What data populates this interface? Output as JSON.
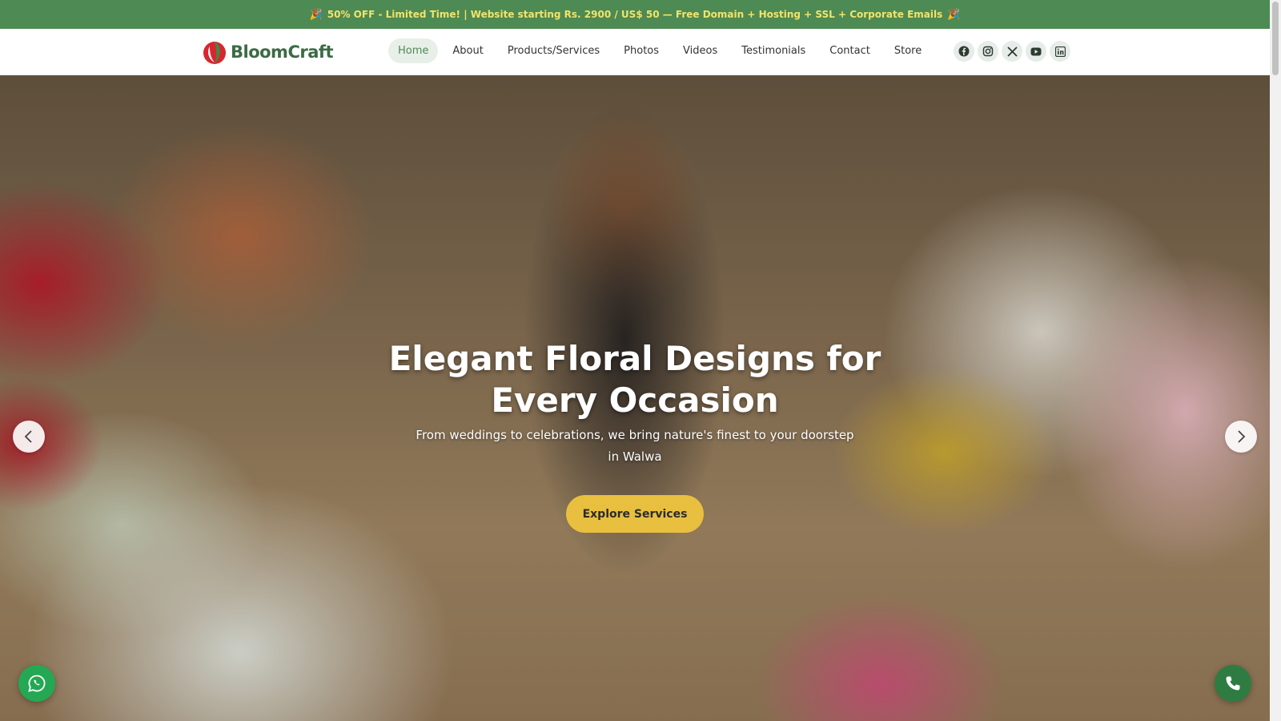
{
  "promo": {
    "emoji_left": "🎉",
    "text": "50% OFF - Limited Time! | Website starting Rs. 2900 / US$ 50 — Free Domain + Hosting + SSL + Corporate Emails",
    "emoji_right": "🎉"
  },
  "brand": {
    "name": "BloomCraft",
    "color": "#3c6b46"
  },
  "nav": {
    "items": [
      {
        "label": "Home"
      },
      {
        "label": "About"
      },
      {
        "label": "Products/Services"
      },
      {
        "label": "Photos"
      },
      {
        "label": "Videos"
      },
      {
        "label": "Testimonials"
      },
      {
        "label": "Contact"
      },
      {
        "label": "Store"
      }
    ],
    "active": "Home"
  },
  "social": [
    "facebook-icon",
    "instagram-icon",
    "x-icon",
    "youtube-icon",
    "linkedin-icon"
  ],
  "hero": {
    "title": "Elegant Floral Designs for Every Occasion",
    "subtitle": "From weddings to celebrations, we bring nature's finest to your doorstep in Walwa",
    "cta": "Explore Services"
  },
  "colors": {
    "accent": "#4e8a53",
    "cta": "#e9bf3f",
    "promo_text": "#f2e36a"
  }
}
